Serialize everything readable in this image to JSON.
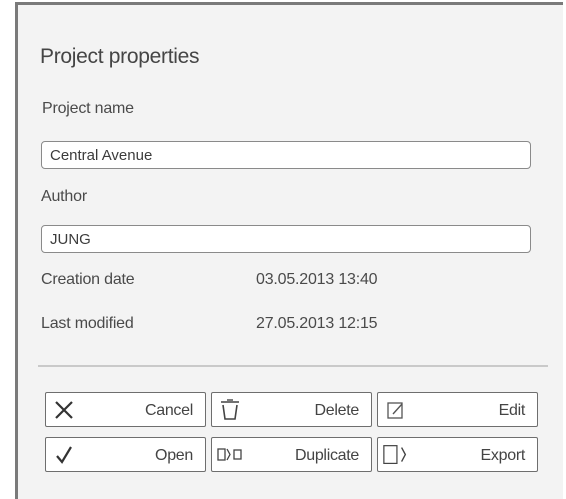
{
  "dialog": {
    "title": "Project properties",
    "project_name_label": "Project name",
    "project_name_value": "Central Avenue",
    "author_label": "Author",
    "author_value": "JUNG",
    "creation_date_label": "Creation date",
    "creation_date_value": "03.05.2013 13:40",
    "last_modified_label": "Last modified",
    "last_modified_value": "27.05.2013 12:15"
  },
  "buttons": {
    "cancel": "Cancel",
    "delete": "Delete",
    "edit": "Edit",
    "open": "Open",
    "duplicate": "Duplicate",
    "export": "Export"
  },
  "icons": {
    "cancel": "close-x-icon",
    "delete": "trash-icon",
    "edit": "edit-pencil-icon",
    "open": "checkmark-icon",
    "duplicate": "duplicate-icon",
    "export": "export-icon"
  },
  "colors": {
    "panel_background": "#f3f3f3",
    "frame_border": "#7a7a7a",
    "field_border": "#8a8a8a",
    "button_border": "#6e6e6e"
  }
}
